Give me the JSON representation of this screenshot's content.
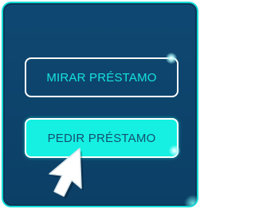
{
  "buttons": {
    "view_loan_label": "MIRAR PRÉSTAMO",
    "request_loan_label": "PEDIR PRÉSTAMO"
  },
  "colors": {
    "panel_bg": "#0e4872",
    "accent": "#16dcd6",
    "primary_button_bg": "#15f0e2",
    "primary_button_text": "#145070",
    "outline_button_text": "#16e3dc",
    "border_white": "#ffffff"
  },
  "icons": {
    "cursor": "mouse-pointer-icon"
  }
}
